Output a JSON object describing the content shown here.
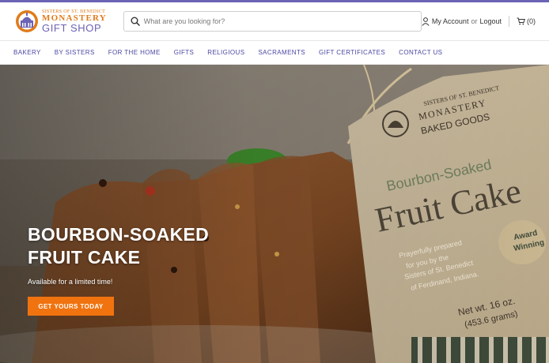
{
  "colors": {
    "brand_purple": "#6b63b5",
    "brand_orange": "#e07b1a",
    "cta_orange": "#f0730f",
    "nav_text": "#4b47a3"
  },
  "logo": {
    "line1": "SISTERS OF ST. BENEDICT",
    "line2": "MONASTERY",
    "line3": "GIFT SHOP"
  },
  "search": {
    "placeholder": "What are you looking for?",
    "value": "",
    "icon": "search-icon"
  },
  "account": {
    "icon": "user-icon",
    "my_account": "My Account",
    "or": "or",
    "logout": "Logout",
    "cart_icon": "cart-icon",
    "cart_count": "(0)"
  },
  "nav": {
    "items": [
      "BAKERY",
      "BY SISTERS",
      "FOR THE HOME",
      "GIFTS",
      "RELIGIOUS",
      "SACRAMENTS",
      "GIFT CERTIFICATES",
      "CONTACT US"
    ]
  },
  "hero": {
    "title": "BOURBON-SOAKED FRUIT CAKE",
    "subtitle": "Available for a limited time!",
    "button": "GET YOURS TODAY",
    "tag": {
      "line1": "SISTERS OF ST. BENEDICT",
      "line2": "MONASTERY",
      "line3": "BAKED GOODS",
      "product_small": "Bourbon-Soaked",
      "product_big": "Fruit Cake",
      "blurb1": "Prayerfully prepared",
      "blurb2": "for you by the",
      "blurb3": "Sisters of St. Benedict",
      "blurb4": "of Ferdinand, Indiana.",
      "net1": "Net wt. 16 oz.",
      "net2": "(453.6 grams)",
      "award1": "Award",
      "award2": "Winning"
    }
  }
}
